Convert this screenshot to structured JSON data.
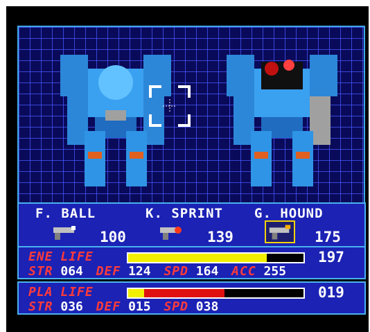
{
  "weapons": [
    {
      "name": "F. BALL",
      "value": "100",
      "selected": false
    },
    {
      "name": "K. SPRINT",
      "value": "139",
      "selected": false
    },
    {
      "name": "G. HOUND",
      "value": "175",
      "selected": true
    }
  ],
  "enemy": {
    "label_tag": "ENE",
    "label_life": "LIFE",
    "life": "197",
    "life_fraction": 0.79,
    "stats": {
      "str_label": "STR",
      "str": "064",
      "def_label": "DEF",
      "def": "124",
      "spd_label": "SPD",
      "spd": "164",
      "acc_label": "ACC",
      "acc": "255"
    }
  },
  "player": {
    "label_tag": "PLA",
    "label_life": "LIFE",
    "life": "019",
    "life_fraction_yellow": 0.09,
    "life_fraction_red": 0.55,
    "stats": {
      "str_label": "STR",
      "str": "036",
      "def_label": "DEF",
      "def": "015",
      "spd_label": "SPD",
      "spd": "038"
    }
  },
  "colors": {
    "panel": "#1b22b4",
    "grid": "#0a0a5a",
    "enemy_bar": "#f2f000",
    "player_bar_yellow": "#f2f000",
    "player_bar_red": "#e01010",
    "label_red": "#ff3b3b",
    "select_frame": "#f5d400"
  }
}
